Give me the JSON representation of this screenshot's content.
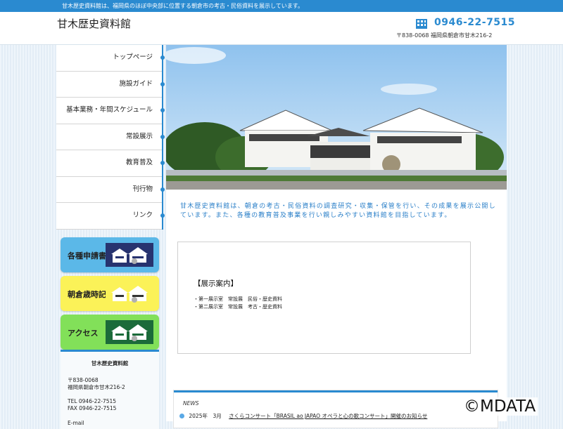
{
  "topbar": {
    "text": "甘木歴史資料館は、福岡県のほぼ中央部に位置する朝倉市の考古・民俗資料を展示しています。"
  },
  "header": {
    "title": "甘木歴史資料館",
    "phone": "0946-22-7515",
    "address": "〒838-0068 福岡県朝倉市甘木216-2",
    "phone_icon": "building-phone-icon"
  },
  "nav": {
    "items": [
      {
        "label": "トップページ"
      },
      {
        "label": "施設ガイド"
      },
      {
        "label": "基本業務・年間スケジュール"
      },
      {
        "label": "常設展示"
      },
      {
        "label": "教育普及"
      },
      {
        "label": "刊行物"
      },
      {
        "label": "リンク"
      }
    ]
  },
  "banners": [
    {
      "label": "各種申請書",
      "color": "#5bb8e8"
    },
    {
      "label": "朝倉歳時記",
      "color": "#fbf258"
    },
    {
      "label": "アクセス",
      "color": "#82e059"
    }
  ],
  "info": {
    "title": "甘木歴史資料館",
    "zip": "〒838-0068",
    "address": "福岡県朝倉市甘木216-2",
    "tel": "TEL 0946-22-7515",
    "fax": "FAX 0946-22-7515",
    "mail": "E-mail"
  },
  "main": {
    "intro": "甘木歴史資料館は、朝倉の考古・民俗資料の調査研究・収集・保管を行い、その成果を展示公開しています。また、各種の教育普及事業を行い親しみやすい資料館を目指しています。",
    "exhibit": {
      "heading": "【展示案内】",
      "rows": [
        "・第一展示室　常設展　民俗・歴史資料",
        "・第二展示室　常設展　考古・歴史資料"
      ]
    },
    "news": {
      "title": "NEWS",
      "items": [
        {
          "date": "2025年　3月",
          "text": "さくらコンサート「BRASIL ao JAPAO オペラと心の歌コンサート」開催のお知らせ"
        }
      ]
    }
  },
  "watermark": "©MDATA",
  "colors": {
    "accent": "#2a8ad0",
    "intro_text": "#2a7fc8"
  }
}
